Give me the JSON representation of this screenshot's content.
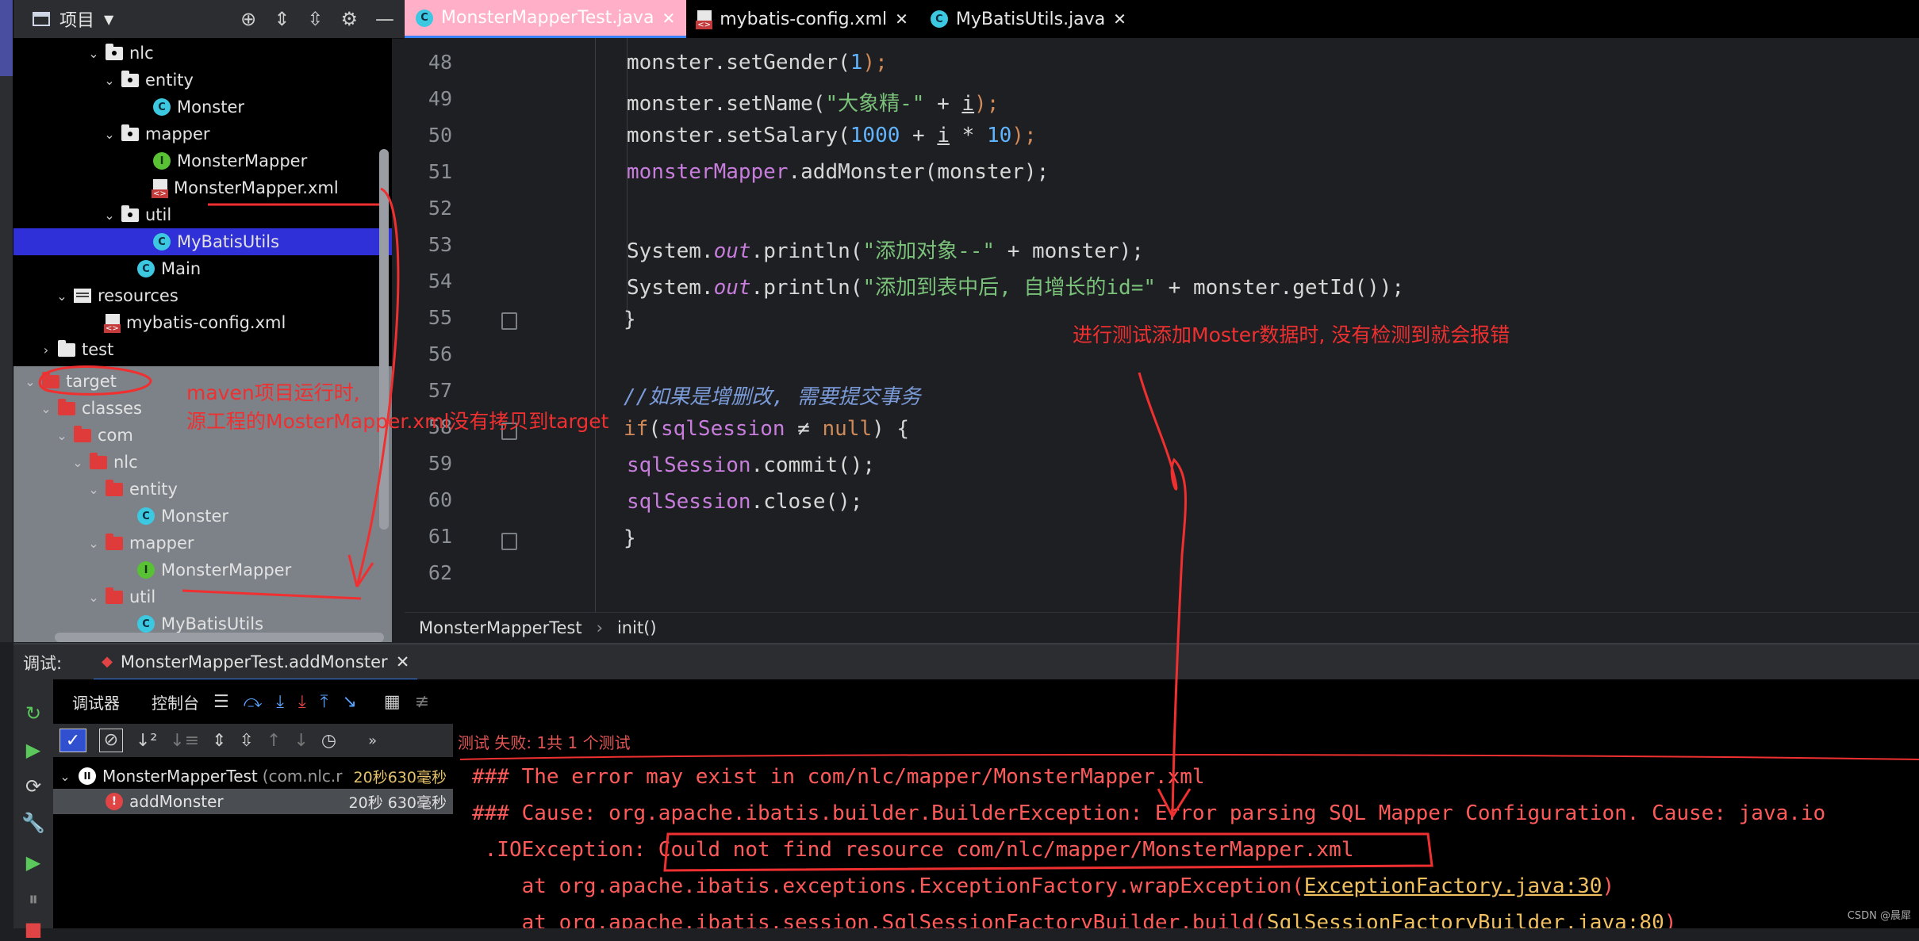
{
  "project_panel": {
    "title": "项目",
    "tree_top": [
      {
        "label": "nlc",
        "kind": "package",
        "depth": 4,
        "chevron": "down"
      },
      {
        "label": "entity",
        "kind": "package",
        "depth": 5,
        "chevron": "down"
      },
      {
        "label": "Monster",
        "kind": "class",
        "depth": 7
      },
      {
        "label": "mapper",
        "kind": "package",
        "depth": 5,
        "chevron": "down"
      },
      {
        "label": "MonsterMapper",
        "kind": "interface",
        "depth": 7
      },
      {
        "label": "MonsterMapper.xml",
        "kind": "xml",
        "depth": 7
      },
      {
        "label": "util",
        "kind": "package",
        "depth": 5,
        "chevron": "down"
      },
      {
        "label": "MyBatisUtils",
        "kind": "class",
        "depth": 7,
        "selected": true
      },
      {
        "label": "Main",
        "kind": "class",
        "depth": 6
      },
      {
        "label": "resources",
        "kind": "resources",
        "depth": 2,
        "chevron": "down"
      },
      {
        "label": "mybatis-config.xml",
        "kind": "xml",
        "depth": 4
      },
      {
        "label": "test",
        "kind": "folder",
        "depth": 1,
        "chevron": "right"
      }
    ],
    "tree_bottom": [
      {
        "label": "target",
        "kind": "red-folder",
        "depth": 0,
        "chevron": "down"
      },
      {
        "label": "classes",
        "kind": "red-folder",
        "depth": 1,
        "chevron": "down"
      },
      {
        "label": "com",
        "kind": "red-folder",
        "depth": 2,
        "chevron": "down"
      },
      {
        "label": "nlc",
        "kind": "red-folder",
        "depth": 3,
        "chevron": "down"
      },
      {
        "label": "entity",
        "kind": "red-folder",
        "depth": 4,
        "chevron": "down"
      },
      {
        "label": "Monster",
        "kind": "class",
        "depth": 6
      },
      {
        "label": "mapper",
        "kind": "red-folder",
        "depth": 4,
        "chevron": "down"
      },
      {
        "label": "MonsterMapper",
        "kind": "interface",
        "depth": 6
      },
      {
        "label": "util",
        "kind": "red-folder",
        "depth": 4,
        "chevron": "down"
      },
      {
        "label": "MyBatisUtils",
        "kind": "class",
        "depth": 6
      }
    ]
  },
  "editor_tabs": [
    {
      "label": "MonsterMapperTest.java",
      "kind": "class",
      "active": true
    },
    {
      "label": "mybatis-config.xml",
      "kind": "xml",
      "active": false
    },
    {
      "label": "MyBatisUtils.java",
      "kind": "class",
      "active": false
    }
  ],
  "editor": {
    "line_numbers": [
      "48",
      "49",
      "50",
      "51",
      "52",
      "53",
      "54",
      "55",
      "56",
      "57",
      "58",
      "59",
      "60",
      "61",
      "62"
    ],
    "code": {
      "l48": [
        "monster.setGender(",
        "1",
        ");"
      ],
      "l49": [
        "monster.setName(",
        "\"大象精-\"",
        " + ",
        "i",
        ");"
      ],
      "l50": [
        "monster.setSalary(",
        "1000",
        " + ",
        "i",
        " * ",
        "10",
        ");"
      ],
      "l51": [
        "monsterMapper",
        ".addMonster(monster);"
      ],
      "l53": [
        "System.",
        "out",
        ".println(",
        "\"添加对象--\"",
        " + monster);"
      ],
      "l54": [
        "System.",
        "out",
        ".println(",
        "\"添加到表中后, 自增长的id=\"",
        " + monster.getId());"
      ],
      "l55": "}",
      "l57": "//如果是增删改, 需要提交事务",
      "l58": [
        "if",
        "(",
        "sqlSession",
        " ≠ ",
        "null",
        ") {"
      ],
      "l59": [
        "sqlSession",
        ".commit();"
      ],
      "l60": [
        "sqlSession",
        ".close();"
      ],
      "l61": "}"
    }
  },
  "breadcrumb": [
    "MonsterMapperTest",
    "›",
    "init()"
  ],
  "debug": {
    "label": "调试:",
    "tab": "MonsterMapperTest.addMonster",
    "sub_tabs": [
      "调试器",
      "控制台"
    ],
    "status": "测试 失败: 1共 1 个测试",
    "tests": [
      {
        "name": "MonsterMapperTest",
        "suffix": "(com.nlc.r",
        "duration": "20秒630毫秒"
      },
      {
        "name": "addMonster",
        "duration": "20秒 630毫秒"
      }
    ],
    "console_lines": [
      "### The error may exist in com/nlc/mapper/MonsterMapper.xml",
      "### Cause: org.apache.ibatis.builder.BuilderException: Error parsing SQL Mapper Configuration. Cause: java.io",
      " .IOException: Could not find resource com/nlc/mapper/MonsterMapper.xml",
      "    at org.apache.ibatis.exceptions.ExceptionFactory.wrapException(",
      "    at org.apache.ibatis.session.SqlSessionFactoryBuilder.build("
    ],
    "console_links": [
      "ExceptionFactory.java:30",
      "SqlSessionFactoryBuilder.java:80"
    ],
    "console_tail": [
      ")",
      ")"
    ]
  },
  "annotations": {
    "left_line1": "maven项目运行时,",
    "left_line2": "源工程的MosterMapper.xml没有拷贝到target",
    "right": "进行测试添加Moster数据时, 没有检测到就会报错"
  },
  "watermark": "CSDN @晨犀",
  "colors": {
    "accent": "#3b82f6",
    "annotation": "#f03030",
    "selection": "#3030d8",
    "error_text": "#ff5a5a"
  }
}
